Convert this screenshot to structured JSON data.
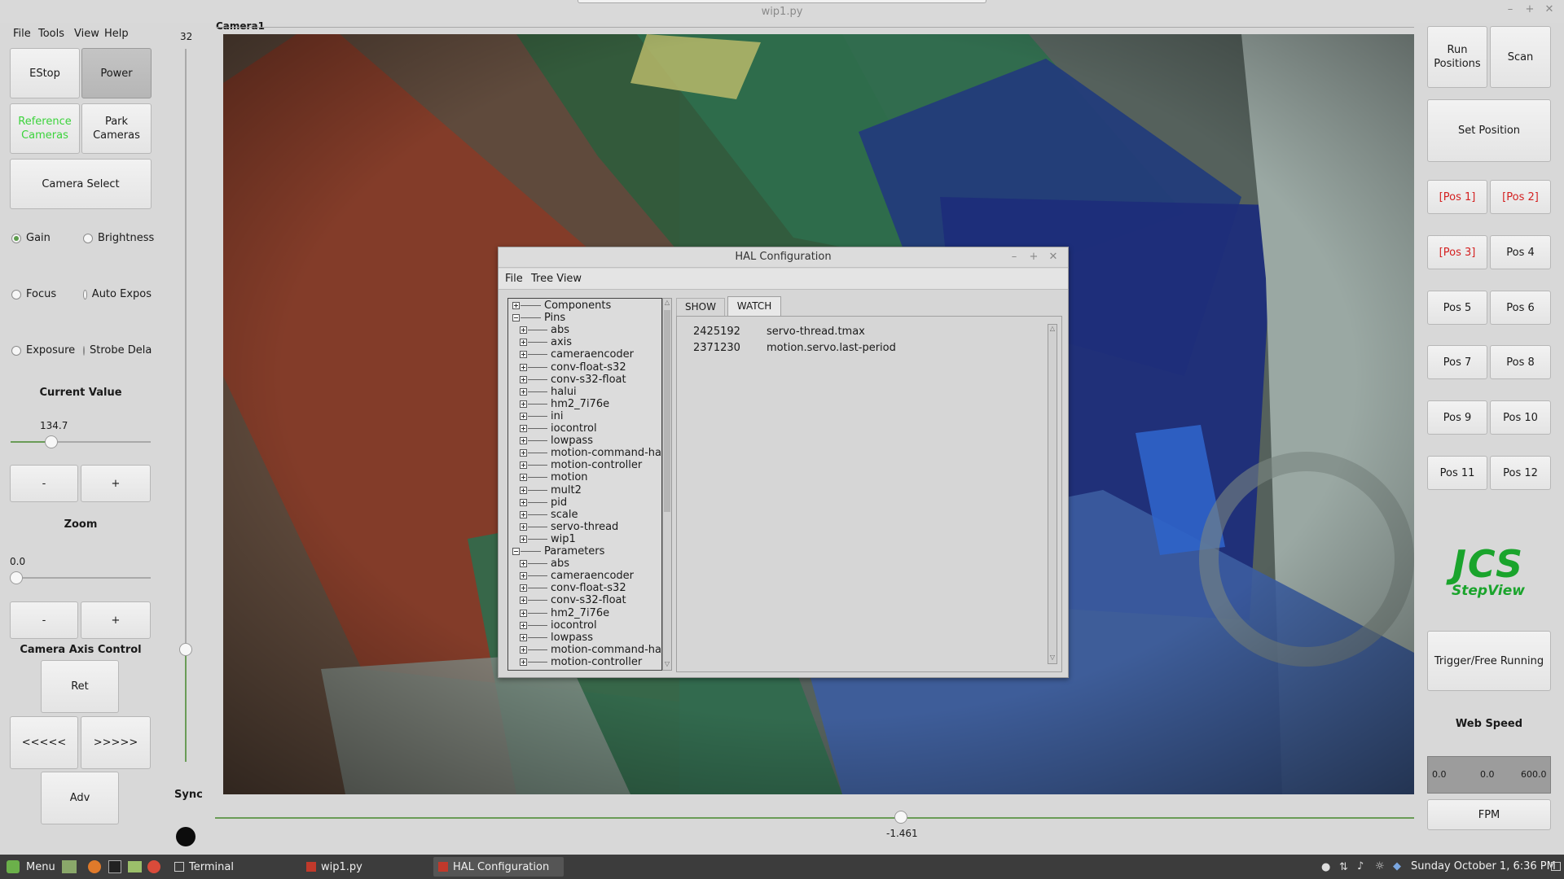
{
  "window": {
    "title": "wip1.py"
  },
  "menu": [
    "File",
    "Tools",
    "View",
    "Help"
  ],
  "left_panel": {
    "estop": "EStop",
    "power": "Power",
    "reference_cameras": "Reference\nCameras",
    "park_cameras": "Park\nCameras",
    "camera_select": "Camera Select",
    "radios": [
      {
        "label": "Gain",
        "checked": true
      },
      {
        "label": "Brightness",
        "checked": false
      },
      {
        "label": "Focus",
        "checked": false
      },
      {
        "label": "Auto Expos",
        "checked": false
      },
      {
        "label": "Exposure",
        "checked": false
      },
      {
        "label": "Strobe Dela",
        "checked": false
      }
    ],
    "current_value_label": "Current Value",
    "current_value": "134.7",
    "minus": "-",
    "plus": "+",
    "zoom_label": "Zoom",
    "zoom_value": "0.0",
    "camera_axis_label": "Camera Axis Control",
    "ret": "Ret",
    "back": "<<<<<",
    "forward": ">>>>>",
    "adv": "Adv"
  },
  "vertical_slider": {
    "value": "32"
  },
  "sync_label": "Sync",
  "camera": {
    "label": "Camera1",
    "bottom_value": "-1.461"
  },
  "hal": {
    "title": "HAL Configuration",
    "menu": [
      "File",
      "Tree View"
    ],
    "tabs": [
      "SHOW",
      "WATCH"
    ],
    "watch": [
      {
        "value": "2425192",
        "name": "servo-thread.tmax"
      },
      {
        "value": "2371230",
        "name": "motion.servo.last-period"
      }
    ],
    "tree": [
      {
        "label": "Components",
        "level": 0,
        "expanded": false
      },
      {
        "label": "Pins",
        "level": 0,
        "expanded": true
      },
      {
        "label": "abs",
        "level": 1
      },
      {
        "label": "axis",
        "level": 1
      },
      {
        "label": "cameraencoder",
        "level": 1
      },
      {
        "label": "conv-float-s32",
        "level": 1
      },
      {
        "label": "conv-s32-float",
        "level": 1
      },
      {
        "label": "halui",
        "level": 1
      },
      {
        "label": "hm2_7i76e",
        "level": 1
      },
      {
        "label": "ini",
        "level": 1
      },
      {
        "label": "iocontrol",
        "level": 1
      },
      {
        "label": "lowpass",
        "level": 1
      },
      {
        "label": "motion-command-har",
        "level": 1
      },
      {
        "label": "motion-controller",
        "level": 1
      },
      {
        "label": "motion",
        "level": 1
      },
      {
        "label": "mult2",
        "level": 1
      },
      {
        "label": "pid",
        "level": 1
      },
      {
        "label": "scale",
        "level": 1
      },
      {
        "label": "servo-thread",
        "level": 1
      },
      {
        "label": "wip1",
        "level": 1
      },
      {
        "label": "Parameters",
        "level": 0,
        "expanded": true
      },
      {
        "label": "abs",
        "level": 1
      },
      {
        "label": "cameraencoder",
        "level": 1
      },
      {
        "label": "conv-float-s32",
        "level": 1
      },
      {
        "label": "conv-s32-float",
        "level": 1
      },
      {
        "label": "hm2_7i76e",
        "level": 1
      },
      {
        "label": "iocontrol",
        "level": 1
      },
      {
        "label": "lowpass",
        "level": 1
      },
      {
        "label": "motion-command-har",
        "level": 1
      },
      {
        "label": "motion-controller",
        "level": 1
      }
    ]
  },
  "right_panel": {
    "run_positions": "Run\nPositions",
    "scan": "Scan",
    "set_position": "Set Position",
    "positions": [
      "[Pos 1]",
      "[Pos 2]",
      "[Pos 3]",
      "Pos 4",
      "Pos 5",
      "Pos 6",
      "Pos 7",
      "Pos 8",
      "Pos 9",
      "Pos 10",
      "Pos 11",
      "Pos 12"
    ],
    "logo_main": "JCS",
    "logo_sub": "StepView",
    "trigger": "Trigger/Free Running",
    "web_speed_label": "Web Speed",
    "speed_min": "0.0",
    "speed_val": "0.0",
    "speed_max": "600.0",
    "fpm": "FPM"
  },
  "taskbar": {
    "menu": "Menu",
    "tasks": [
      "Terminal",
      "wip1.py",
      "HAL Configuration"
    ],
    "clock": "Sunday October 1,  6:36 PM"
  },
  "colors": {
    "accent_green": "#3bd33b",
    "pos_red": "#d42020",
    "logo_green": "#1aa42c"
  }
}
